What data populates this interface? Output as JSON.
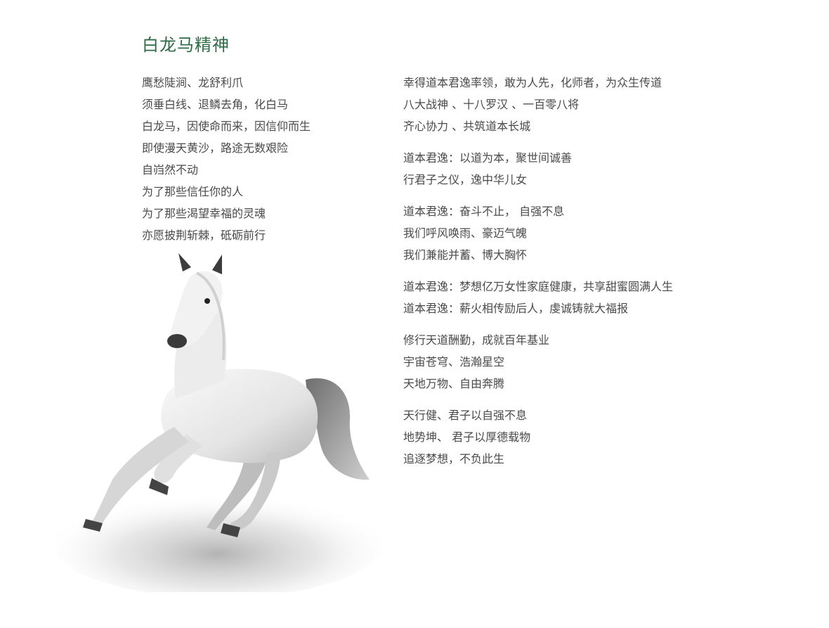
{
  "title": "白龙马精神",
  "left_lines": [
    "鹰愁陡涧、龙舒利爪",
    "须垂白线、退鳞去角，化白马",
    "白龙马，因使命而来，因信仰而生",
    "即使漫天黄沙，路途无数艰险",
    "自岿然不动",
    "为了那些信任你的人",
    "为了那些渴望幸福的灵魂",
    "亦愿披荆斩棘，砥砺前行"
  ],
  "stanzas": [
    {
      "lines": [
        "幸得道本君逸率领，敢为人先，化师者，为众生传道",
        "八大战神 、十八罗汉 、一百零八将",
        "齐心协力 、共筑道本长城"
      ]
    },
    {
      "lines": [
        "道本君逸：以道为本，聚世间诚善",
        "行君子之仪，逸中华儿女"
      ]
    },
    {
      "lines": [
        "道本君逸：奋斗不止， 自强不息",
        "我们呼风唤雨、豪迈气魄",
        "我们兼能并蓄、博大胸怀"
      ]
    },
    {
      "lines": [
        "道本君逸：梦想亿万女性家庭健康，共享甜蜜圆满人生",
        "道本君逸：薪火相传励后人，虔诚铸就大福报"
      ]
    },
    {
      "lines": [
        "修行天道酬勤，成就百年基业",
        "宇宙苍穹、浩瀚星空",
        "天地万物、自由奔腾"
      ]
    },
    {
      "lines": [
        "天行健、君子以自强不息",
        "地势坤、 君子以厚德载物",
        "追逐梦想，不负此生"
      ]
    }
  ],
  "image": {
    "subject": "white-horse-galloping",
    "colors": {
      "title": "#2e6a45",
      "text": "#4a4a4a"
    }
  }
}
